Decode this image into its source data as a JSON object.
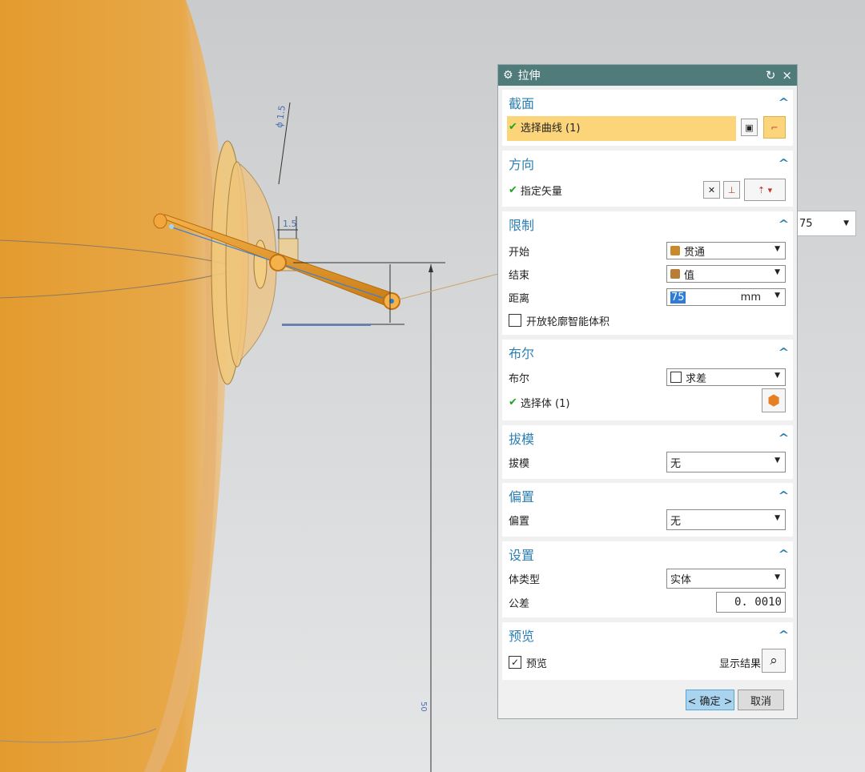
{
  "dialog": {
    "title": "拉伸",
    "reset_icon": "↻",
    "close_icon": "×",
    "sections": {
      "section": {
        "title": "截面",
        "select_curve": "选择曲线 (1)"
      },
      "direction": {
        "title": "方向",
        "specify_vector": "指定矢量"
      },
      "limits": {
        "title": "限制",
        "start_label": "开始",
        "start_value": "贯通",
        "end_label": "结束",
        "end_value": "值",
        "distance_label": "距离",
        "distance_value": "75",
        "distance_unit": "mm",
        "open_profile": "开放轮廓智能体积"
      },
      "boolean": {
        "title": "布尔",
        "boolean_label": "布尔",
        "boolean_value": "求差",
        "select_body": "选择体 (1)"
      },
      "draft": {
        "title": "拔模",
        "draft_label": "拔模",
        "draft_value": "无"
      },
      "offset": {
        "title": "偏置",
        "offset_label": "偏置",
        "offset_value": "无"
      },
      "settings": {
        "title": "设置",
        "body_type_label": "体类型",
        "body_type_value": "实体",
        "tolerance_label": "公差",
        "tolerance_value": "0. 0010"
      },
      "preview": {
        "title": "预览",
        "preview_label": "预览",
        "show_result": "显示结果"
      }
    },
    "ok_label": "< 确定 >",
    "cancel_label": "取消"
  },
  "floating_input": {
    "value": "75"
  },
  "dimensions": {
    "dia": "ϕ 1.5",
    "small": "1.5",
    "vertical": "50"
  },
  "colors": {
    "title_bar": "#4f7c7a",
    "section_title": "#2d7fb1",
    "selected_row": "#fcd47a",
    "model_orange": "#e8a23a",
    "ok_button": "#a9d4ef"
  }
}
